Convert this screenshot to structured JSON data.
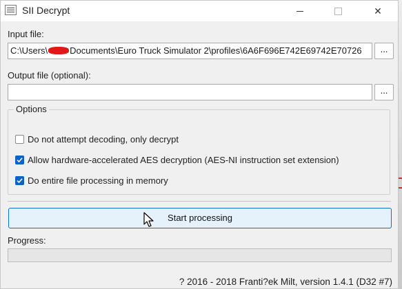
{
  "window": {
    "title": "SII Decrypt",
    "minimize_icon": "minimize-icon",
    "maximize_icon": "maximize-icon",
    "close_symbol": "✕"
  },
  "input": {
    "label": "Input file:",
    "value_before_redaction": "C:\\Users\\",
    "value_after_redaction": "Documents\\Euro Truck Simulator 2\\profiles\\6A6F696E742E69742E70726",
    "browse_label": "..."
  },
  "output": {
    "label": "Output file (optional):",
    "value": "",
    "browse_label": "..."
  },
  "options": {
    "title": "Options",
    "items": [
      {
        "label": "Do not attempt decoding, only decrypt",
        "checked": false
      },
      {
        "label": "Allow hardware-accelerated AES decryption (AES-NI instruction set extension)",
        "checked": true
      },
      {
        "label": "Do entire file processing in memory",
        "checked": true
      }
    ]
  },
  "start_button": "Start processing",
  "progress": {
    "label": "Progress:",
    "value": 0
  },
  "status_bar": "? 2016 - 2018 Franti?ek Milt, version 1.4.1 (D32 #7)",
  "colors": {
    "accent": "#0b63c7",
    "button_bg": "#e5f1fb",
    "redaction": "#e01818"
  }
}
